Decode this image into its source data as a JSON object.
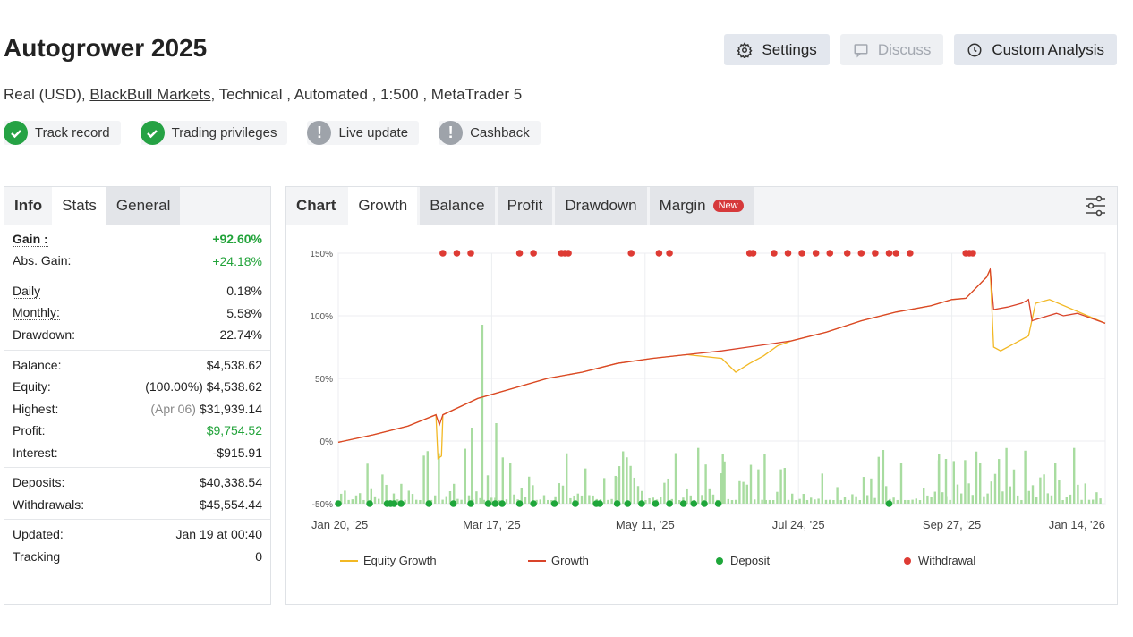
{
  "header": {
    "title": "Autogrower 2025",
    "buttons": {
      "settings": "Settings",
      "discuss": "Discuss",
      "custom_analysis": "Custom Analysis"
    }
  },
  "subtitle": {
    "prefix": "Real (USD),",
    "broker": "BlackBull Markets",
    "suffix": ", Technical , Automated , 1:500 , MetaTrader 5"
  },
  "badges": [
    {
      "label": "Track record",
      "status": "ok"
    },
    {
      "label": "Trading privileges",
      "status": "ok"
    },
    {
      "label": "Live update",
      "status": "warn"
    },
    {
      "label": "Cashback",
      "status": "warn"
    }
  ],
  "left_panel": {
    "tabs": [
      "Info",
      "Stats",
      "General"
    ],
    "gain": {
      "label": "Gain :",
      "value": "+92.60%"
    },
    "abs_gain": {
      "label": "Abs. Gain:",
      "value": "+24.18%"
    },
    "daily": {
      "label": "Daily",
      "value": "0.18%"
    },
    "monthly": {
      "label": "Monthly:",
      "value": "5.58%"
    },
    "drawdown": {
      "label": "Drawdown:",
      "value": "22.74%"
    },
    "balance": {
      "label": "Balance:",
      "value": "$4,538.62"
    },
    "equity": {
      "label": "Equity:",
      "note": "(100.00%)",
      "value": "$4,538.62"
    },
    "highest": {
      "label": "Highest:",
      "note": "(Apr 06)",
      "value": "$31,939.14"
    },
    "profit": {
      "label": "Profit:",
      "value": "$9,754.52"
    },
    "interest": {
      "label": "Interest:",
      "value": "-$915.91"
    },
    "deposits": {
      "label": "Deposits:",
      "value": "$40,338.54"
    },
    "withdrawals": {
      "label": "Withdrawals:",
      "value": "$45,554.44"
    },
    "updated": {
      "label": "Updated:",
      "value": "Jan 19 at 00:40"
    },
    "tracking": {
      "label": "Tracking",
      "value": "0"
    }
  },
  "chart_panel": {
    "tabs": [
      "Chart",
      "Growth",
      "Balance",
      "Profit",
      "Drawdown",
      "Margin"
    ],
    "new_badge": "New",
    "legend": [
      "Equity Growth",
      "Growth",
      "Deposit",
      "Withdrawal"
    ]
  },
  "colors": {
    "growth": "#d9442a",
    "equity": "#f2b824",
    "deposit": "#1ea63a",
    "withdrawal": "#de3b34",
    "volume": "#a8dca0"
  },
  "chart_data": {
    "type": "line",
    "yticks": [
      "150%",
      "100%",
      "50%",
      "0%",
      "-50%"
    ],
    "ylim": [
      -50,
      150
    ],
    "xticks": [
      "Jan 20, '25",
      "Mar 17, '25",
      "May 11, '25",
      "Jul 24, '25",
      "Sep 27, '25",
      "Jan 14, '26"
    ],
    "grid": true,
    "series": [
      {
        "name": "Growth",
        "points": [
          [
            0,
            -1
          ],
          [
            0.05,
            5
          ],
          [
            0.1,
            12
          ],
          [
            0.14,
            21
          ],
          [
            0.145,
            13
          ],
          [
            0.15,
            21
          ],
          [
            0.2,
            34
          ],
          [
            0.25,
            42
          ],
          [
            0.3,
            50
          ],
          [
            0.35,
            55
          ],
          [
            0.4,
            62
          ],
          [
            0.45,
            66
          ],
          [
            0.5,
            69
          ],
          [
            0.55,
            72
          ],
          [
            0.6,
            76
          ],
          [
            0.65,
            80
          ],
          [
            0.7,
            87
          ],
          [
            0.75,
            96
          ],
          [
            0.8,
            103
          ],
          [
            0.85,
            108
          ],
          [
            0.88,
            113
          ],
          [
            0.9,
            114
          ],
          [
            0.93,
            131
          ],
          [
            0.935,
            137
          ],
          [
            0.94,
            105
          ],
          [
            0.96,
            107
          ],
          [
            0.98,
            110
          ],
          [
            0.99,
            113
          ],
          [
            0.995,
            96
          ],
          [
            1.0,
            97
          ],
          [
            1.03,
            102
          ],
          [
            1.04,
            100
          ],
          [
            1.06,
            102
          ],
          [
            1.1,
            94
          ]
        ]
      },
      {
        "name": "Equity Growth",
        "points": [
          [
            0,
            -1
          ],
          [
            0.05,
            5
          ],
          [
            0.1,
            12
          ],
          [
            0.14,
            21
          ],
          [
            0.143,
            -14
          ],
          [
            0.148,
            -12
          ],
          [
            0.15,
            21
          ],
          [
            0.2,
            34
          ],
          [
            0.25,
            42
          ],
          [
            0.3,
            50
          ],
          [
            0.35,
            55
          ],
          [
            0.4,
            62
          ],
          [
            0.45,
            66
          ],
          [
            0.5,
            69
          ],
          [
            0.55,
            66
          ],
          [
            0.57,
            55
          ],
          [
            0.59,
            62
          ],
          [
            0.61,
            68
          ],
          [
            0.63,
            76
          ],
          [
            0.65,
            80
          ],
          [
            0.7,
            87
          ],
          [
            0.75,
            96
          ],
          [
            0.8,
            103
          ],
          [
            0.85,
            108
          ],
          [
            0.88,
            113
          ],
          [
            0.9,
            114
          ],
          [
            0.93,
            131
          ],
          [
            0.935,
            137
          ],
          [
            0.94,
            75
          ],
          [
            0.95,
            72
          ],
          [
            0.97,
            78
          ],
          [
            0.99,
            84
          ],
          [
            1.0,
            110
          ],
          [
            1.02,
            113
          ],
          [
            1.1,
            94
          ]
        ]
      }
    ]
  }
}
